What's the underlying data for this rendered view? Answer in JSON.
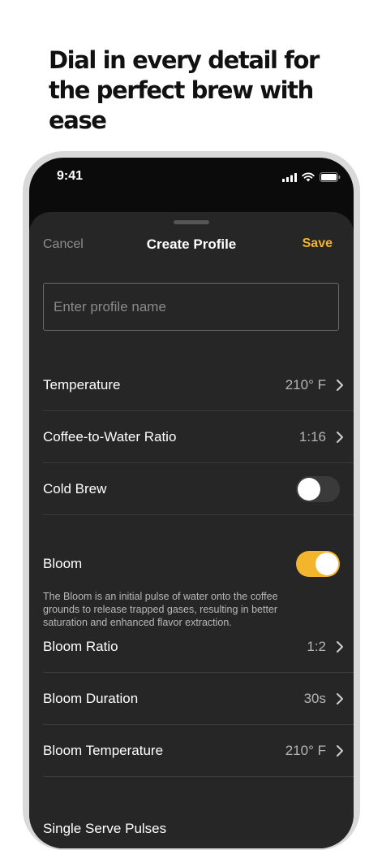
{
  "promo": {
    "headline": "Dial in every detail for the perfect brew with ease"
  },
  "status_bar": {
    "time": "9:41",
    "icons": [
      "signal-bars-icon",
      "wifi-icon",
      "battery-icon"
    ]
  },
  "nav": {
    "cancel_label": "Cancel",
    "title": "Create Profile",
    "save_label": "Save"
  },
  "profile_name": {
    "placeholder": "Enter profile name",
    "value": ""
  },
  "settings": {
    "temperature": {
      "label": "Temperature",
      "value": "210° F"
    },
    "ratio": {
      "label": "Coffee-to-Water Ratio",
      "value": "1:16"
    },
    "cold_brew": {
      "label": "Cold Brew",
      "on": false
    },
    "bloom": {
      "label": "Bloom",
      "on": true,
      "description": "The Bloom is an initial pulse of water onto the coffee grounds to release trapped gases, resulting in better saturation and enhanced flavor extraction."
    },
    "bloom_ratio": {
      "label": "Bloom Ratio",
      "value": "1:2"
    },
    "bloom_duration": {
      "label": "Bloom Duration",
      "value": "30s"
    },
    "bloom_temperature": {
      "label": "Bloom Temperature",
      "value": "210° F"
    },
    "single_serve": {
      "label": "Single Serve Pulses"
    }
  },
  "colors": {
    "accent": "#f2b52c",
    "sheet_background": "#262626",
    "screen_background": "#0b0b0b"
  }
}
